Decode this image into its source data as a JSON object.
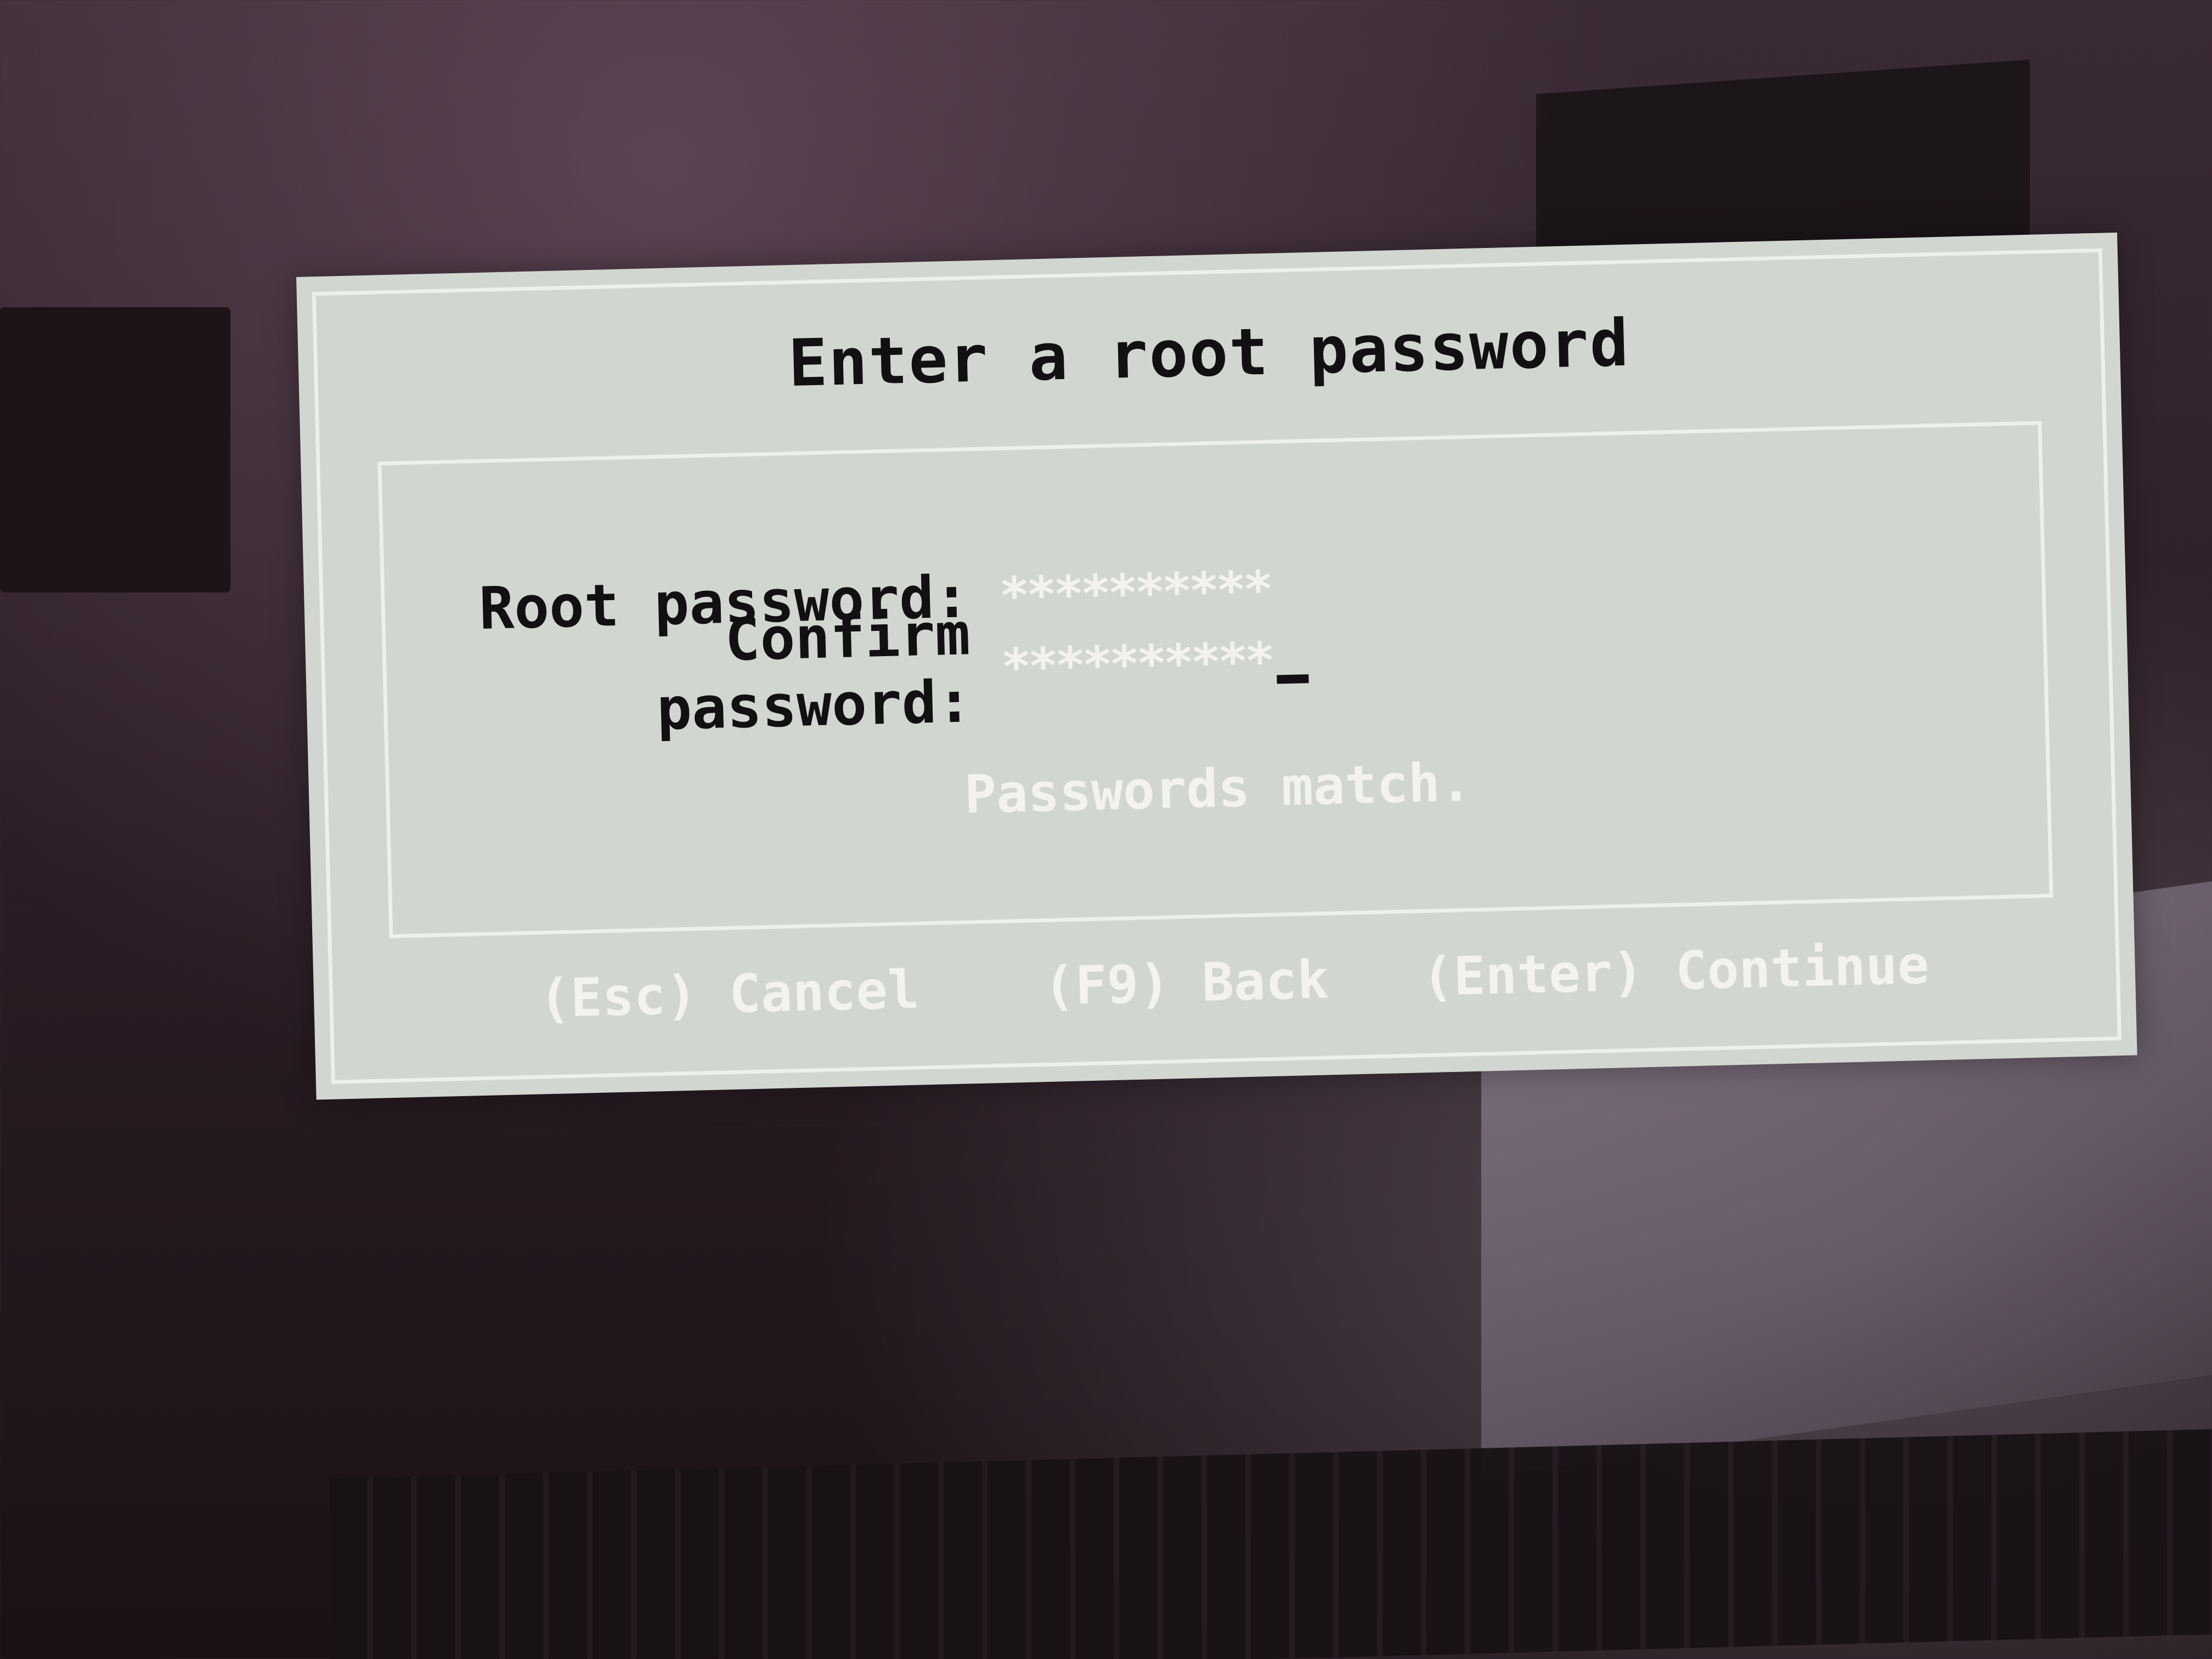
{
  "dialog": {
    "title": "Enter a root password",
    "fields": [
      {
        "label": "Root password:",
        "value": "**********"
      },
      {
        "label": "Confirm password:",
        "value": "**********"
      }
    ],
    "status": "Passwords match.",
    "actions": {
      "cancel": "(Esc) Cancel",
      "back": "(F9) Back",
      "continue": "(Enter) Continue"
    }
  },
  "colors": {
    "dialog_background": "#d2d6d0",
    "frame_line": "#eef0ea",
    "label_text": "#111111",
    "highlight_text": "#f2f3ef"
  }
}
